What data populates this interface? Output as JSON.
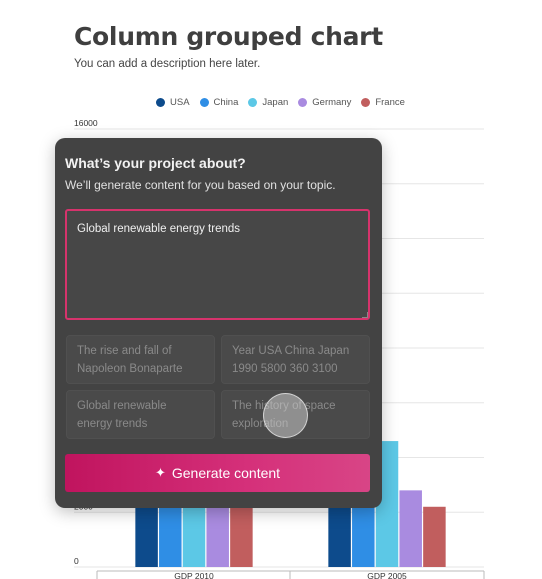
{
  "header": {
    "title": "Column grouped chart",
    "description": "You can add a description here later."
  },
  "chart_data": {
    "type": "bar",
    "categories": [
      "GDP 2010",
      "GDP 2005"
    ],
    "series": [
      {
        "name": "USA",
        "color": "#0d4b8c",
        "values": [
          15000,
          13000
        ]
      },
      {
        "name": "China",
        "color": "#2f8ee5",
        "values": [
          6100,
          2300
        ]
      },
      {
        "name": "Japan",
        "color": "#5cc8e6",
        "values": [
          5700,
          4600
        ]
      },
      {
        "name": "Germany",
        "color": "#a98be0",
        "values": [
          3400,
          2800
        ]
      },
      {
        "name": "France",
        "color": "#c15e5e",
        "values": [
          2600,
          2200
        ]
      }
    ],
    "ylim": [
      0,
      16000
    ],
    "y_ticks": [
      "0",
      "2000",
      "16000"
    ],
    "grid": true,
    "legend": "top-center"
  },
  "dialog": {
    "title": "What’s your project about?",
    "subtitle": "We’ll generate content for you based on your topic.",
    "topic_value": "Global renewable energy trends",
    "suggestions": [
      "The rise and fall of Napoleon Bonaparte",
      "Year USA China Japan 1990 5800 360 3100",
      "Global renewable energy trends",
      "The history of space exploration"
    ],
    "generate_label": "Generate content",
    "sparkle_icon": "sparkle-icon"
  }
}
